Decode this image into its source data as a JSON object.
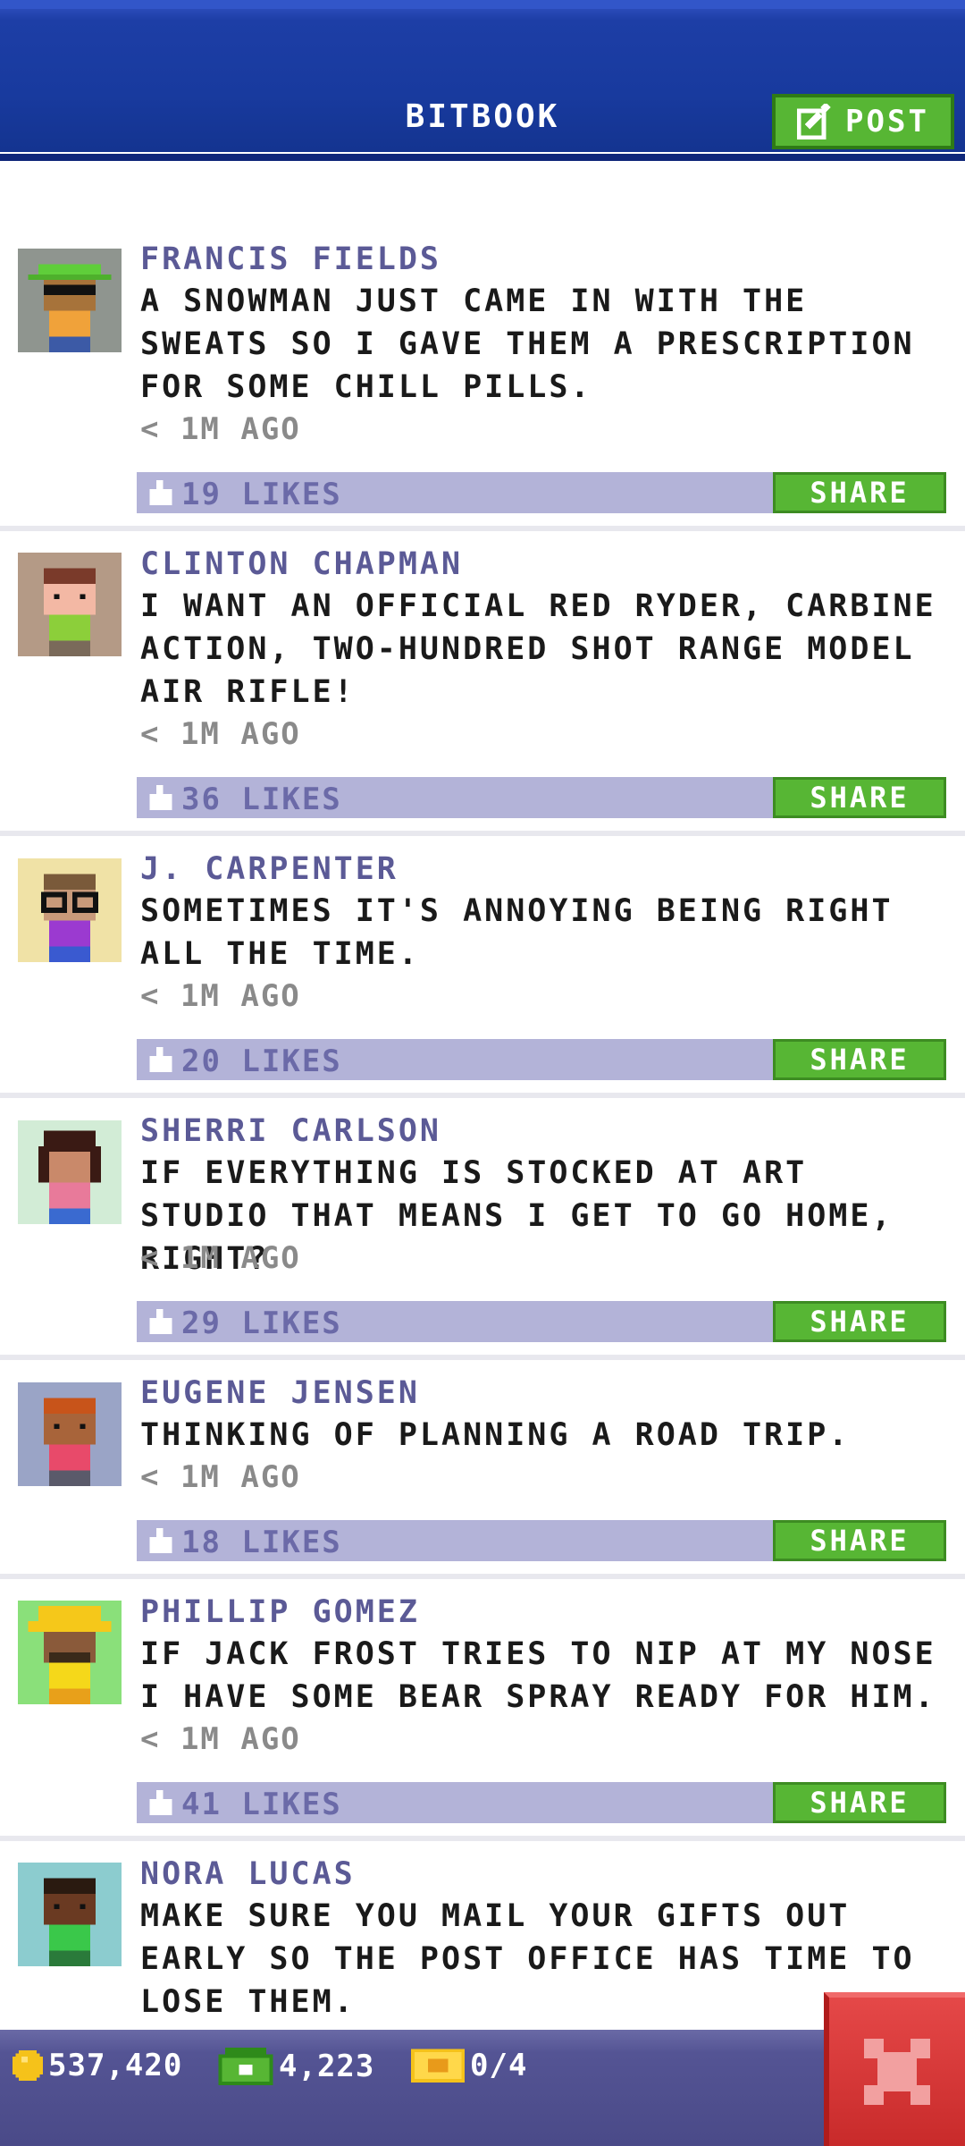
{
  "header": {
    "title": "BITBOOK",
    "post_label": "POST"
  },
  "posts": [
    {
      "name": "FRANCIS FIELDS",
      "message": "A SNOWMAN JUST CAME IN WITH THE SWEATS SO I GAVE THEM A PRESCRIPTION FOR SOME CHILL PILLS.",
      "time": "< 1M AGO",
      "likes": "19 LIKES",
      "share": "SHARE",
      "avatar_bg": "#8f958f"
    },
    {
      "name": "CLINTON CHAPMAN",
      "message": "I WANT AN OFFICIAL RED RYDER, CARBINE ACTION, TWO-HUNDRED SHOT RANGE MODEL AIR RIFLE!",
      "time": "< 1M AGO",
      "likes": "36 LIKES",
      "share": "SHARE",
      "avatar_bg": "#b49a86"
    },
    {
      "name": "J. CARPENTER",
      "message": "SOMETIMES IT'S ANNOYING BEING RIGHT ALL THE TIME.",
      "time": "< 1M AGO",
      "likes": "20 LIKES",
      "share": "SHARE",
      "avatar_bg": "#f0e2a6"
    },
    {
      "name": "SHERRI CARLSON",
      "message": "IF EVERYTHING IS STOCKED AT ART STUDIO THAT MEANS I GET TO GO HOME, RIGHT?",
      "time": "< 1M AGO",
      "likes": "29 LIKES",
      "share": "SHARE",
      "avatar_bg": "#d2ecd6"
    },
    {
      "name": "EUGENE JENSEN",
      "message": "THINKING OF PLANNING A ROAD TRIP.",
      "time": "< 1M AGO",
      "likes": "18 LIKES",
      "share": "SHARE",
      "avatar_bg": "#9aa4c6"
    },
    {
      "name": "PHILLIP GOMEZ",
      "message": "IF JACK FROST TRIES TO NIP AT MY NOSE I HAVE SOME BEAR SPRAY READY FOR HIM.",
      "time": "< 1M AGO",
      "likes": "41 LIKES",
      "share": "SHARE",
      "avatar_bg": "#8ae07a"
    },
    {
      "name": "NORA LUCAS",
      "message": "MAKE SURE YOU MAIL YOUR GIFTS OUT EARLY SO THE POST OFFICE HAS TIME TO LOSE THEM.",
      "avatar_bg": "#8ccccf"
    }
  ],
  "status": {
    "coins": "537,420",
    "bux": "4,223",
    "tickets": "0/4"
  },
  "icons": {
    "post": "edit-icon",
    "like": "thumbs-up-icon",
    "coin": "coin-icon",
    "bux": "bux-icon",
    "ticket": "ticket-icon",
    "close": "close-icon"
  }
}
